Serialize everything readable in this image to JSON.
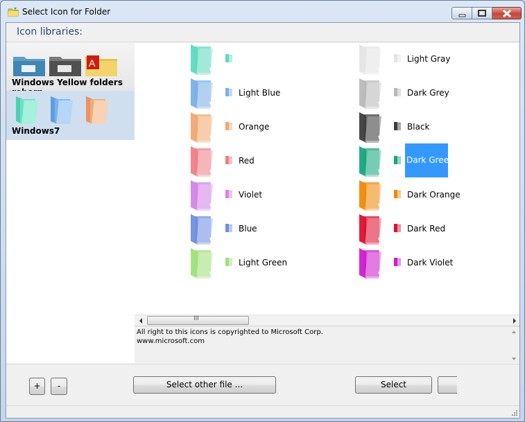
{
  "window": {
    "title": "Select Icon for Folder"
  },
  "libraries_header": "Icon libraries:",
  "libraries": [
    {
      "name": "Windows Yellow folders reborn",
      "selected": false
    },
    {
      "name": "Windows7",
      "selected": true
    }
  ],
  "icons": [
    {
      "label": "",
      "color": "#5fd9c1"
    },
    {
      "label": "Light Blue",
      "color": "#7ab0e8"
    },
    {
      "label": "Orange",
      "color": "#f2a870"
    },
    {
      "label": "Red",
      "color": "#ee7f86"
    },
    {
      "label": "Violet",
      "color": "#d484e8"
    },
    {
      "label": "Blue",
      "color": "#6f8fe0"
    },
    {
      "label": "Light Green",
      "color": "#9fe07a"
    },
    {
      "label": "Light Gray",
      "color": "#e4e4e4"
    },
    {
      "label": "Dark Grey",
      "color": "#b9b9b9"
    },
    {
      "label": "Black",
      "color": "#3d3d3d"
    },
    {
      "label": "Dark Green",
      "color": "#17a57e",
      "selected": true
    },
    {
      "label": "Dark Orange",
      "color": "#f08a0a"
    },
    {
      "label": "Dark Red",
      "color": "#df1030"
    },
    {
      "label": "Dark Violet",
      "color": "#d01ccd"
    }
  ],
  "scrollbar_grip": "III",
  "copyright": {
    "line1": "All right to this icons is copyrighted to Microsoft Corp.",
    "line2": "www.microsoft.com"
  },
  "buttons": {
    "add": "+",
    "remove": "-",
    "select_other": "Select other file ...",
    "select": "Select",
    "cancel": ""
  },
  "colors": {
    "selection": "#3399ff",
    "library_selected_bg": "#cfdff0"
  }
}
